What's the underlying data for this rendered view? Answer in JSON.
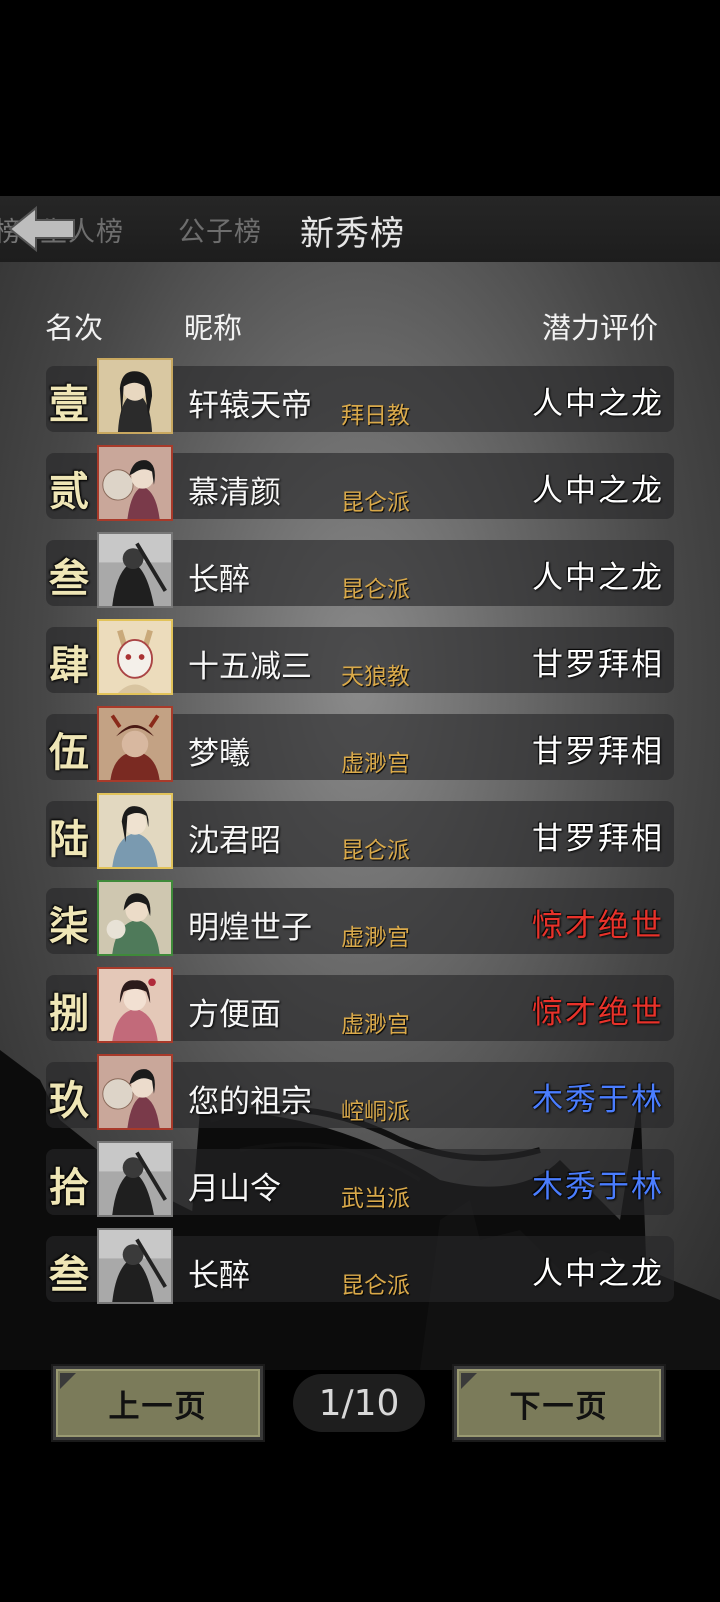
{
  "tabs": [
    {
      "label": "榜"
    },
    {
      "label": "生人榜"
    },
    {
      "label": "公子榜"
    },
    {
      "label": "新秀榜"
    }
  ],
  "headers": {
    "rank": "名次",
    "nickname": "昵称",
    "potential": "潜力评价"
  },
  "rows": [
    {
      "rank": "壹",
      "nickname": "轩辕天帝",
      "sect": "拜日教",
      "potential": "人中之龙",
      "potential_color": "#ffffff",
      "avatar": "female-swordsman-avatar",
      "frame": "#c8a860"
    },
    {
      "rank": "贰",
      "nickname": "慕清颜",
      "sect": "昆仑派",
      "potential": "人中之龙",
      "potential_color": "#ffffff",
      "avatar": "female-fan-avatar",
      "frame": "#a83a2a"
    },
    {
      "rank": "叁",
      "nickname": "长醉",
      "sect": "昆仑派",
      "potential": "人中之龙",
      "potential_color": "#ffffff",
      "avatar": "grey-swordsman-avatar",
      "frame": "#777777"
    },
    {
      "rank": "肆",
      "nickname": "十五减三",
      "sect": "天狼教",
      "potential": "甘罗拜相",
      "potential_color": "#ffffff",
      "avatar": "masked-fox-avatar",
      "frame": "#e2c35a"
    },
    {
      "rank": "伍",
      "nickname": "梦曦",
      "sect": "虚渺宫",
      "potential": "甘罗拜相",
      "potential_color": "#ffffff",
      "avatar": "armored-warrior-avatar",
      "frame": "#a83a2a"
    },
    {
      "rank": "陆",
      "nickname": "沈君昭",
      "sect": "昆仑派",
      "potential": "甘罗拜相",
      "potential_color": "#ffffff",
      "avatar": "scholar-avatar",
      "frame": "#e2c35a"
    },
    {
      "rank": "柒",
      "nickname": "明煌世子",
      "sect": "虚渺宫",
      "potential": "惊才绝世",
      "potential_color": "#e8322a",
      "avatar": "green-robe-avatar",
      "frame": "#3f8a3a"
    },
    {
      "rank": "捌",
      "nickname": "方便面",
      "sect": "虚渺宫",
      "potential": "惊才绝世",
      "potential_color": "#e8322a",
      "avatar": "pink-maiden-avatar",
      "frame": "#a83a2a"
    },
    {
      "rank": "玖",
      "nickname": "您的祖宗",
      "sect": "崆峒派",
      "potential": "木秀于林",
      "potential_color": "#4a7dff",
      "avatar": "female-fan-avatar",
      "frame": "#a83a2a"
    },
    {
      "rank": "拾",
      "nickname": "月山令",
      "sect": "武当派",
      "potential": "木秀于林",
      "potential_color": "#4a7dff",
      "avatar": "grey-swordsman-avatar",
      "frame": "#777777"
    },
    {
      "rank": "叁",
      "nickname": "长醉",
      "sect": "昆仑派",
      "potential": "人中之龙",
      "potential_color": "#ffffff",
      "avatar": "grey-swordsman-avatar",
      "frame": "#777777"
    }
  ],
  "pagination": {
    "prev_label": "上一页",
    "next_label": "下一页",
    "page": "1/10"
  }
}
